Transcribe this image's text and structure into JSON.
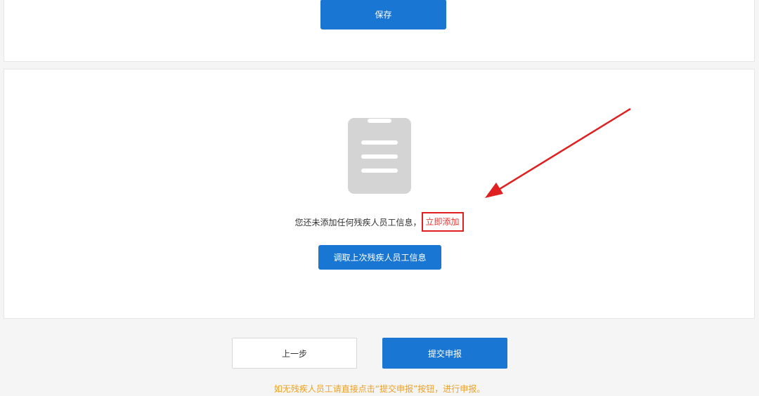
{
  "top_panel": {
    "save_label": "保存"
  },
  "empty_state": {
    "icon": "clipboard-icon",
    "message": "您还未添加任何残疾人员工信息，",
    "add_link_label": "立即添加",
    "recall_button_label": "调取上次残疾人员工信息"
  },
  "footer": {
    "prev_label": "上一步",
    "submit_label": "提交申报",
    "hint": "如无残疾人员工请直接点击“提交申报”按钮，进行申报。"
  },
  "colors": {
    "primary": "#1976d2",
    "link_red": "#e53935",
    "annotation_red": "#e02020",
    "hint_orange": "#f0a020",
    "icon_gray": "#d4d4d4"
  }
}
